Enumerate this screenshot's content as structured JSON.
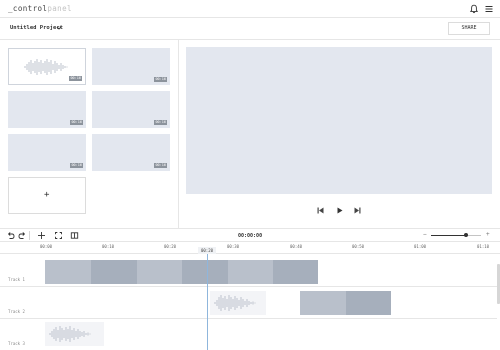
{
  "app": {
    "logo_part1": "_control",
    "logo_part2": "panel"
  },
  "header": {
    "icons": [
      "bell-icon",
      "menu-icon"
    ]
  },
  "project": {
    "name": "Untitled Project",
    "share_label": "SHARE"
  },
  "media": {
    "items": [
      {
        "duration": "00:16"
      },
      {
        "duration": "00:16"
      },
      {
        "duration": "00:16"
      },
      {
        "duration": "00:16"
      },
      {
        "duration": "00:16"
      },
      {
        "duration": "00:16"
      }
    ],
    "add_label": "+"
  },
  "timeline": {
    "timecode": "00:00:00",
    "playhead_label": "00:20",
    "ruler": [
      "00:00",
      "00:10",
      "00:20",
      "00:30",
      "00:40",
      "00:50",
      "01:00",
      "01:10"
    ],
    "zoom_minus": "−",
    "zoom_plus": "+",
    "zoom_level": 0.7,
    "tracks": [
      {
        "label": "Track 1"
      },
      {
        "label": "Track 2"
      },
      {
        "label": "Track 3"
      }
    ]
  },
  "colors": {
    "clip_light": "#b9c0cb",
    "clip_dark": "#a6afbc",
    "preview_bg": "#e3e7ef",
    "playhead": "#8fb6dc"
  }
}
